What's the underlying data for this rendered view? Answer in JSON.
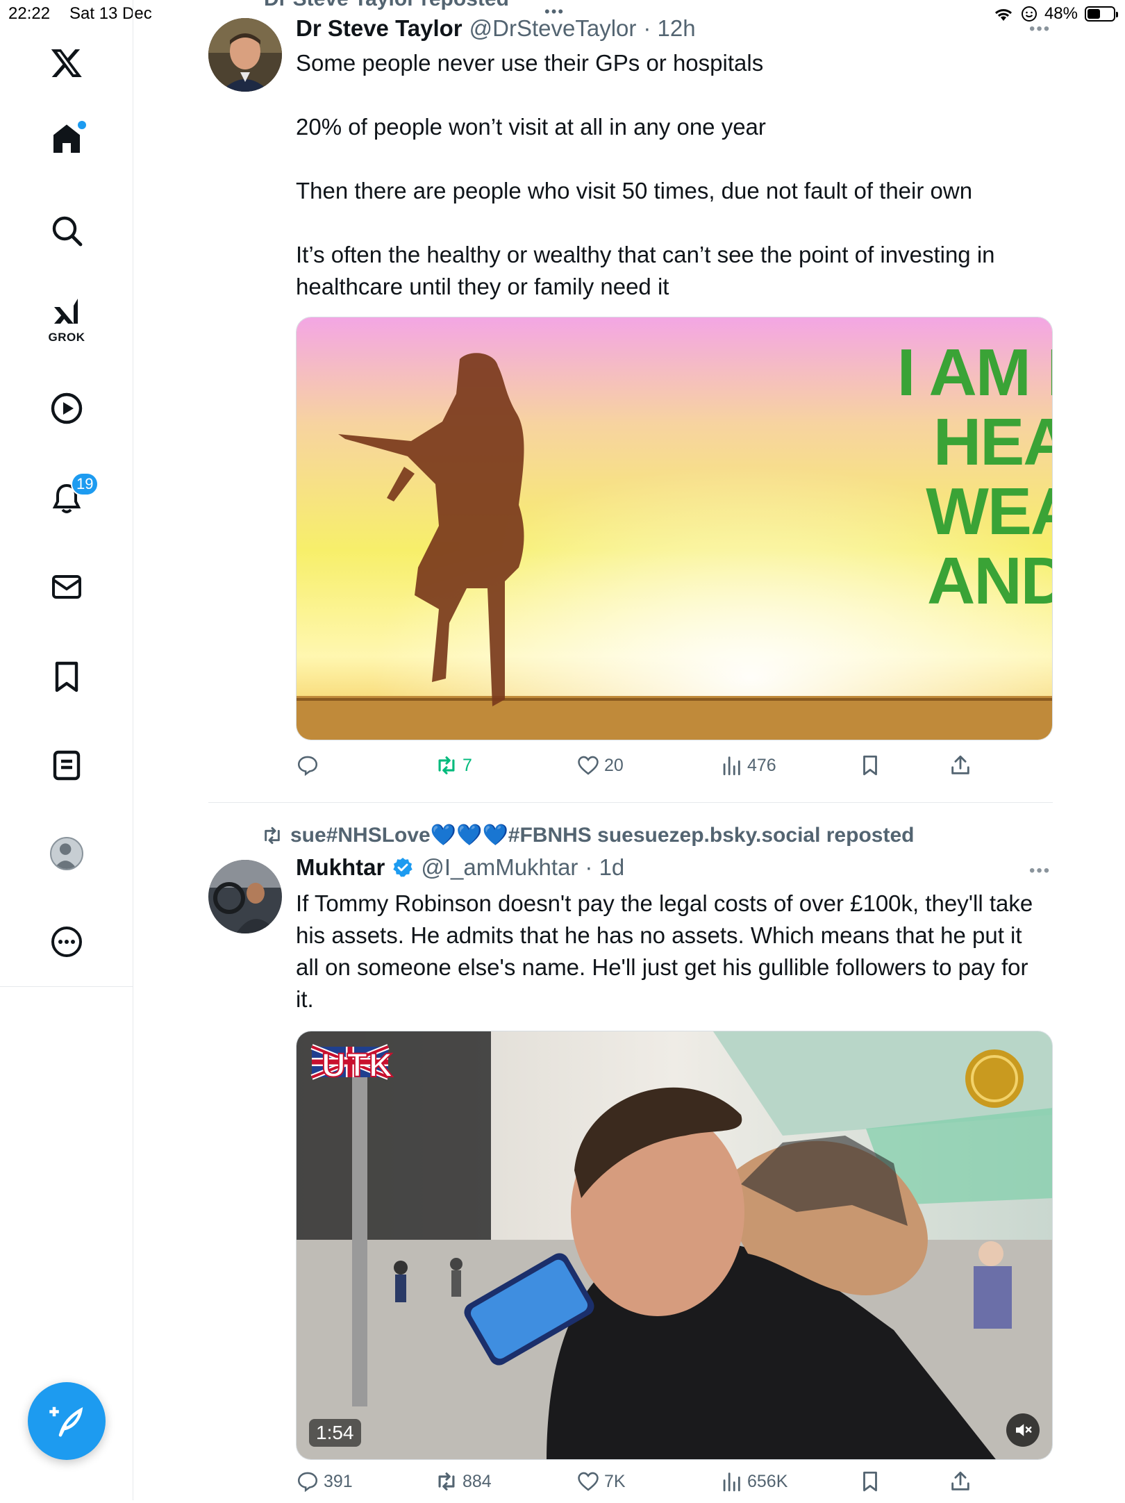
{
  "status_bar": {
    "time": "22:22",
    "date": "Sat 13 Dec",
    "battery": "48%",
    "battery_level_percent": 48
  },
  "sidebar": {
    "logo": "x-logo-icon",
    "items": [
      {
        "name": "home",
        "icon": "home-icon",
        "has_dot": true
      },
      {
        "name": "search",
        "icon": "search-icon"
      },
      {
        "name": "grok",
        "icon": "grok-icon",
        "label": "GROK"
      },
      {
        "name": "video",
        "icon": "play-icon"
      },
      {
        "name": "notifications",
        "icon": "bell-icon",
        "badge": "19"
      },
      {
        "name": "messages",
        "icon": "mail-icon"
      },
      {
        "name": "bookmarks",
        "icon": "bookmark-icon"
      },
      {
        "name": "lists",
        "icon": "list-icon"
      },
      {
        "name": "profile",
        "icon": "avatar"
      },
      {
        "name": "more",
        "icon": "more-circle-icon"
      }
    ],
    "compose": "compose-icon"
  },
  "feed": {
    "cut_header": "Dr Steve Taylor reposted",
    "tweets": [
      {
        "name": "Dr Steve Taylor",
        "handle": "@DrSteveTaylor",
        "time": "· 12h",
        "text": [
          "Some people never use their GPs or hospitals",
          "20% of people won’t visit at all in any one year",
          "Then there are people who visit 50 times, due not fault of their own",
          "It’s often the healthy or wealthy that can’t see the point of investing in healthcare until they or family need it"
        ],
        "image_text": "I AM HAPPY, HEALTHY, WEALTHY, AND WISE",
        "stats": {
          "replies": "",
          "reposts": "7",
          "likes": "20",
          "views": "476"
        }
      },
      {
        "repost_by": "sue#NHSLove💙💙💙#FBNHS suesuezep.bsky.social reposted",
        "name": "Mukhtar",
        "verified": true,
        "handle": "@I_amMukhtar",
        "time": "· 1d",
        "text": [
          "If Tommy Robinson doesn't pay the legal costs of over £100k, they'll take his assets. He admits that he has no assets. Which means that he put it all on someone else's name. He'll just get his gullible followers to pay for it."
        ],
        "video_overlay": "UTK",
        "video_duration": "1:54",
        "stats": {
          "replies": "391",
          "reposts": "884",
          "likes": "7K",
          "views": "656K"
        }
      }
    ]
  },
  "colors": {
    "accent": "#1d9bf0",
    "repost_green": "#00ba7c",
    "muted": "#536471",
    "headline_green": "#3aa336"
  }
}
